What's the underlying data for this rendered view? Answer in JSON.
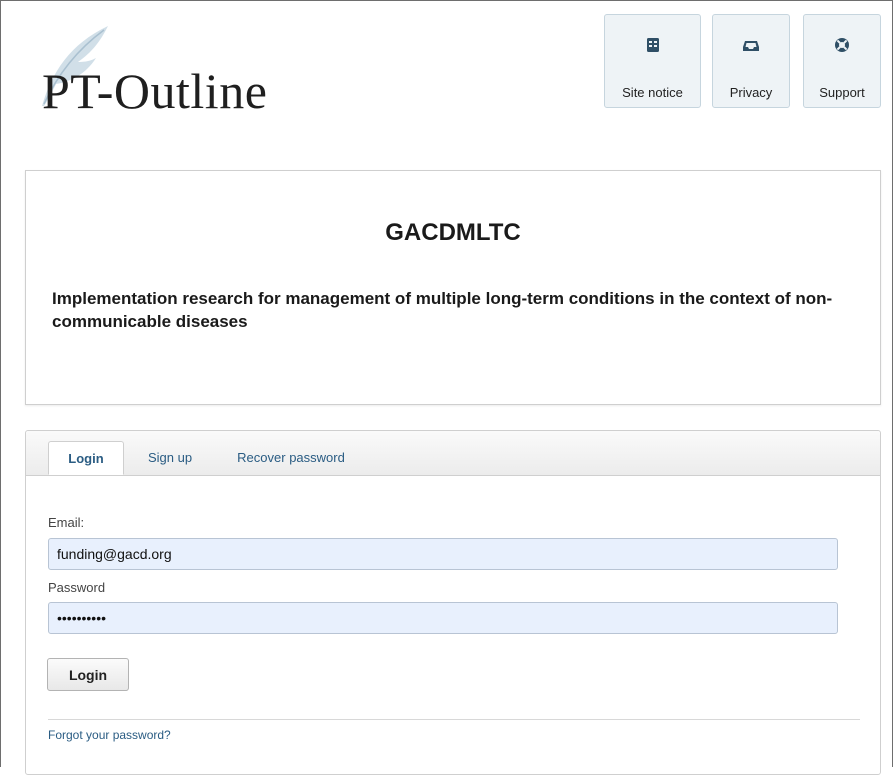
{
  "header": {
    "logo_text": "PT-Outline",
    "buttons": [
      {
        "label": "Site notice",
        "icon": "site-notice-icon"
      },
      {
        "label": "Privacy",
        "icon": "inbox-icon"
      },
      {
        "label": "Support",
        "icon": "lifebuoy-icon"
      }
    ]
  },
  "project": {
    "title": "GACDMLTC",
    "description": "Implementation research for management of multiple long-term conditions in the context of non-communicable diseases"
  },
  "login": {
    "tabs": [
      "Login",
      "Sign up",
      "Recover password"
    ],
    "active_tab": "Login",
    "email_label": "Email:",
    "email_value": "funding@gacd.org",
    "password_label": "Password",
    "password_value": "••••••••••",
    "submit_label": "Login",
    "forgot_link": "Forgot your password?"
  },
  "colors": {
    "link": "#2a5c83",
    "field_bg": "#e8f0fd",
    "button_bg": "#eef3f6"
  }
}
